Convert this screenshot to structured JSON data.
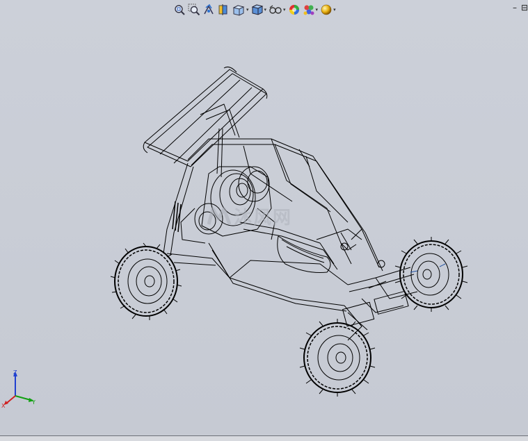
{
  "toolbar": {
    "items": [
      {
        "name": "zoom-to-fit",
        "icon": "zoom-fit-icon",
        "dropdown": false
      },
      {
        "name": "zoom-to-area",
        "icon": "zoom-area-icon",
        "dropdown": false
      },
      {
        "name": "previous-view",
        "icon": "previous-view-icon",
        "dropdown": false
      },
      {
        "name": "section-view",
        "icon": "section-view-icon",
        "dropdown": false
      },
      {
        "name": "view-orientation",
        "icon": "view-orientation-icon",
        "dropdown": true
      },
      {
        "name": "display-style",
        "icon": "display-style-icon",
        "dropdown": true
      },
      {
        "name": "hide-show-items",
        "icon": "hide-show-icon",
        "dropdown": true
      },
      {
        "name": "edit-appearance",
        "icon": "appearance-icon",
        "dropdown": false
      },
      {
        "name": "apply-scene",
        "icon": "scene-icon",
        "dropdown": true
      },
      {
        "name": "view-settings",
        "icon": "view-settings-icon",
        "dropdown": true
      }
    ],
    "dropdown_glyph": "▾"
  },
  "window_controls": {
    "minimize": "–",
    "restore": "⊟"
  },
  "watermark": {
    "text": "沐风网",
    "icon": "mf-logo-icon"
  },
  "triad": {
    "x_label": "X",
    "y_label": "Y",
    "z_label": "Z",
    "colors": {
      "x": "#d02020",
      "y": "#10a010",
      "z": "#2040d0"
    }
  },
  "colors": {
    "viewport": "#c8ccd5",
    "wire": "#000000"
  }
}
